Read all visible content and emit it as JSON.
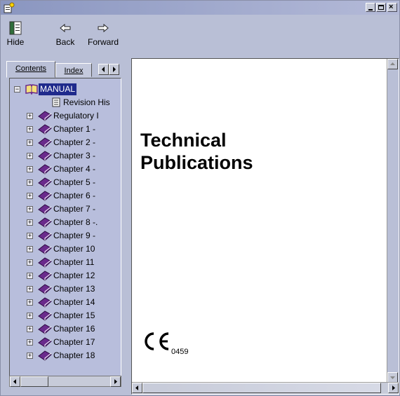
{
  "toolbar": {
    "hide_label": "Hide",
    "back_label": "Back",
    "forward_label": "Forward"
  },
  "tabs": {
    "contents_label": "Contents",
    "index_label": "Index"
  },
  "tree": {
    "root_label": "MANUAL",
    "items": [
      {
        "label": "Revision His",
        "icon": "page-icon"
      },
      {
        "label": "Regulatory I",
        "icon": "book-icon"
      },
      {
        "label": "Chapter 1 -",
        "icon": "book-icon"
      },
      {
        "label": "Chapter 2 -",
        "icon": "book-icon"
      },
      {
        "label": "Chapter 3 -",
        "icon": "book-icon"
      },
      {
        "label": "Chapter 4 -",
        "icon": "book-icon"
      },
      {
        "label": "Chapter 5 -",
        "icon": "book-icon"
      },
      {
        "label": "Chapter 6 -",
        "icon": "book-icon"
      },
      {
        "label": "Chapter 7 -",
        "icon": "book-icon"
      },
      {
        "label": "Chapter 8 -.",
        "icon": "book-icon"
      },
      {
        "label": "Chapter 9 -",
        "icon": "book-icon"
      },
      {
        "label": "Chapter 10",
        "icon": "book-icon"
      },
      {
        "label": "Chapter 11",
        "icon": "book-icon"
      },
      {
        "label": "Chapter 12",
        "icon": "book-icon"
      },
      {
        "label": "Chapter 13",
        "icon": "book-icon"
      },
      {
        "label": "Chapter 14",
        "icon": "book-icon"
      },
      {
        "label": "Chapter 15",
        "icon": "book-icon"
      },
      {
        "label": "Chapter 16",
        "icon": "book-icon"
      },
      {
        "label": "Chapter 17",
        "icon": "book-icon"
      },
      {
        "label": "Chapter 18",
        "icon": "book-icon"
      }
    ]
  },
  "document": {
    "title_line1": "Technical",
    "title_line2": "Publications",
    "ce_number": "0459"
  },
  "colors": {
    "window_bg": "#b9bfd6",
    "tree_bg": "#b8bedc",
    "selection": "#1f2a8c",
    "book": "#6a2a8c"
  }
}
